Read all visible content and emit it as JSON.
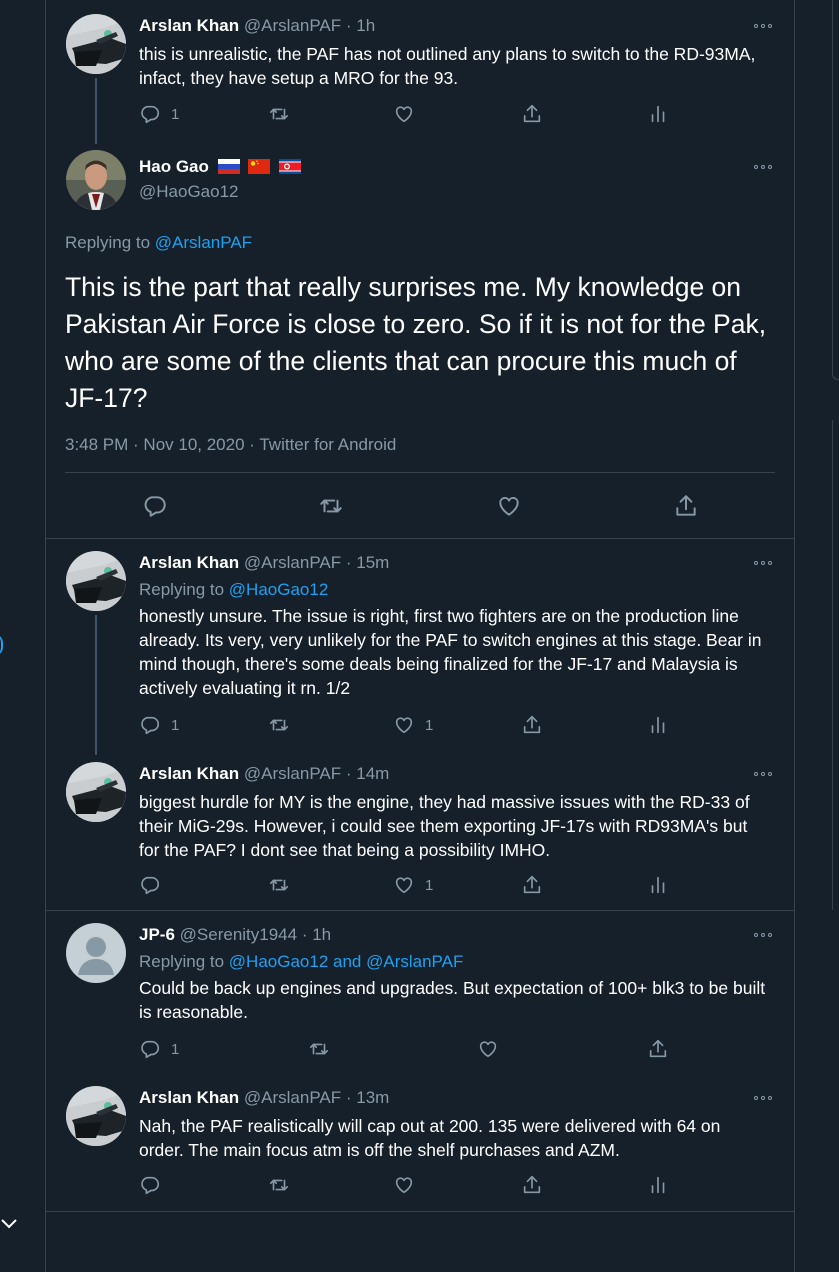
{
  "tweets": [
    {
      "name": "Arslan Khan",
      "handle": "@ArslanPAF",
      "time": "· 1h",
      "text": "this is unrealistic, the PAF has not outlined any plans to switch to the RD-93MA, infact, they have setup a MRO for the 93.",
      "reply_count": "1",
      "like_count": ""
    },
    {
      "name": "Hao Gao",
      "handle": "@HaoGao12",
      "flags": [
        "russia-flag",
        "china-flag",
        "north-korea-flag"
      ],
      "replying_prefix": "Replying to",
      "replying_to": "@ArslanPAF",
      "text": "This is the part that really surprises me. My knowledge on Pakistan Air Force is close to zero. So if it is not for the Pak, who are some of the clients that can procure this much of JF-17?",
      "meta": "3:48 PM · Nov 10, 2020 · Twitter for Android"
    },
    {
      "name": "Arslan Khan",
      "handle": "@ArslanPAF",
      "time": "· 15m",
      "replying_prefix": "Replying to",
      "replying_to": "@HaoGao12",
      "text": "honestly unsure. The issue is right, first two fighters are on the production line already. Its very, very unlikely for the PAF to switch engines at this stage. Bear in mind though, there's some deals being finalized for the JF-17 and Malaysia is actively evaluating it rn. 1/2",
      "reply_count": "1",
      "like_count": "1"
    },
    {
      "name": "Arslan Khan",
      "handle": "@ArslanPAF",
      "time": "· 14m",
      "text": "biggest hurdle for MY is the engine, they had massive issues with the RD-33 of their MiG-29s. However, i could see them exporting JF-17s with RD93MA's but for the PAF? I dont see that being a possibility IMHO.",
      "reply_count": "",
      "like_count": "1"
    },
    {
      "name": "JP-6",
      "handle": "@Serenity1944",
      "time": "· 1h",
      "replying_prefix": "Replying to",
      "replying_to": "@HaoGao12 and @ArslanPAF",
      "text": "Could be back up engines and upgrades. But expectation of 100+ blk3 to be built is reasonable.",
      "reply_count": "1",
      "like_count": ""
    },
    {
      "name": "Arslan Khan",
      "handle": "@ArslanPAF",
      "time": "· 13m",
      "text": "Nah, the PAF realistically will cap out at 200. 135 were delivered with 64 on order. The main focus atm is off the shelf purchases and AZM.",
      "reply_count": "",
      "like_count": ""
    }
  ],
  "colors": {
    "background": "#15202b",
    "border": "#38444d",
    "muted": "#8899a6",
    "link": "#1da1f2",
    "thread_line": "#3d5466"
  }
}
